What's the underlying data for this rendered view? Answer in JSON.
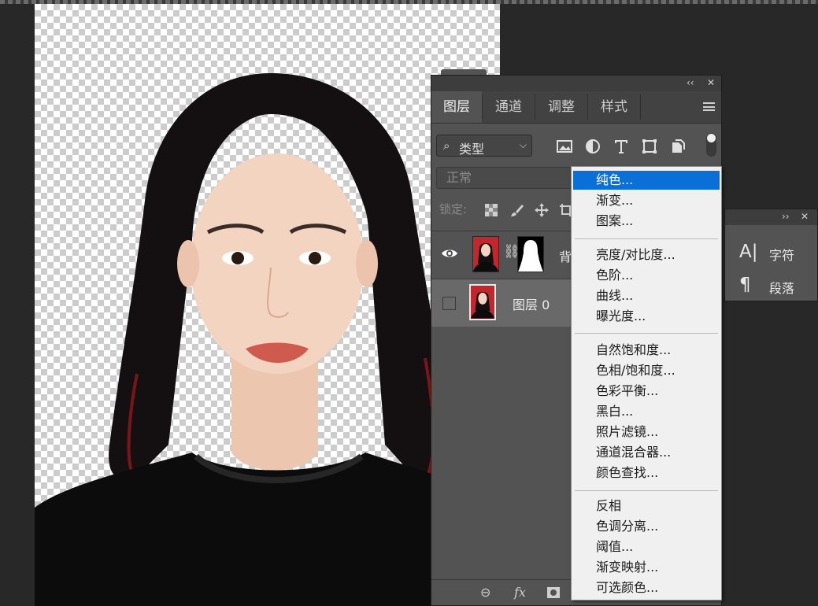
{
  "layers_panel": {
    "tabs": [
      "图层",
      "通道",
      "调整",
      "样式"
    ],
    "filter": {
      "label": "类型"
    },
    "blend_mode": "正常",
    "lock_label": "锁定:",
    "layers": [
      {
        "name": "背",
        "visible": true,
        "has_mask": true
      },
      {
        "name": "图层 0",
        "visible": false,
        "has_mask": false
      }
    ]
  },
  "char_panel": {
    "items": [
      {
        "icon": "A|",
        "label": "字符"
      },
      {
        "icon": "¶",
        "label": "段落"
      }
    ]
  },
  "adjust_menu": {
    "groups": [
      [
        "纯色...",
        "渐变...",
        "图案..."
      ],
      [
        "亮度/对比度...",
        "色阶...",
        "曲线...",
        "曝光度..."
      ],
      [
        "自然饱和度...",
        "色相/饱和度...",
        "色彩平衡...",
        "黑白...",
        "照片滤镜...",
        "通道混合器...",
        "颜色查找..."
      ],
      [
        "反相",
        "色调分离...",
        "阈值...",
        "渐变映射...",
        "可选颜色..."
      ]
    ],
    "highlighted": "纯色..."
  },
  "colors": {
    "highlight": "#0a6fd6",
    "panel_bg": "#535353",
    "thumb_bg": "#c2272d"
  }
}
